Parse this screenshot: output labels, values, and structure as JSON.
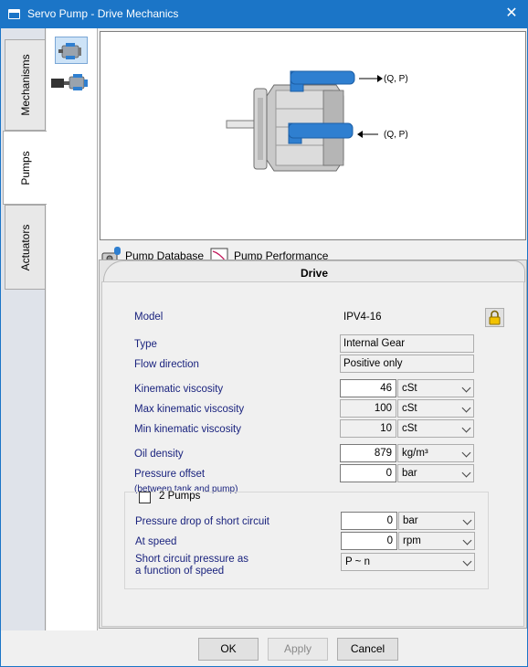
{
  "window": {
    "title": "Servo Pump - Drive Mechanics",
    "close_glyph": "✕"
  },
  "side_tabs": [
    {
      "label": "Mechanisms"
    },
    {
      "label": "Pumps"
    },
    {
      "label": "Actuators"
    }
  ],
  "preview": {
    "out_label": "(Q, P)",
    "in_label": "(Q, P)"
  },
  "toolstrip": {
    "db_label": "Pump Database",
    "perf_label": "Pump Performance"
  },
  "drive_tab": {
    "label": "Drive"
  },
  "form": {
    "model_label": "Model",
    "model_value": "IPV4-16",
    "type_label": "Type",
    "type_value": "Internal Gear",
    "flow_label": "Flow direction",
    "flow_value": "Positive only",
    "kin_label": "Kinematic viscosity",
    "kin_value": "46",
    "kin_unit": "cSt",
    "max_label": "Max kinematic viscosity",
    "max_value": "100",
    "max_unit": "cSt",
    "min_label": "Min kinematic viscosity",
    "min_value": "10",
    "min_unit": "cSt",
    "oil_label": "Oil density",
    "oil_value": "879",
    "oil_unit": "kg/m³",
    "poff_label": "Pressure offset",
    "poff_sub": "(between tank and pump)",
    "poff_value": "0",
    "poff_unit": "bar",
    "two_pumps_label": "2 Pumps",
    "pdrop_label": "Pressure drop of short circuit",
    "pdrop_value": "0",
    "pdrop_unit": "bar",
    "speed_label": "At speed",
    "speed_value": "0",
    "speed_unit": "rpm",
    "scp_label1": "Short circuit pressure as",
    "scp_label2": "a function of speed",
    "scp_value": "P ~ n"
  },
  "buttons": {
    "ok": "OK",
    "apply": "Apply",
    "cancel": "Cancel"
  },
  "colors": {
    "title_bar": "#1b75c7",
    "label_text": "#1a237e",
    "pump_port": "#2f7fd0"
  }
}
